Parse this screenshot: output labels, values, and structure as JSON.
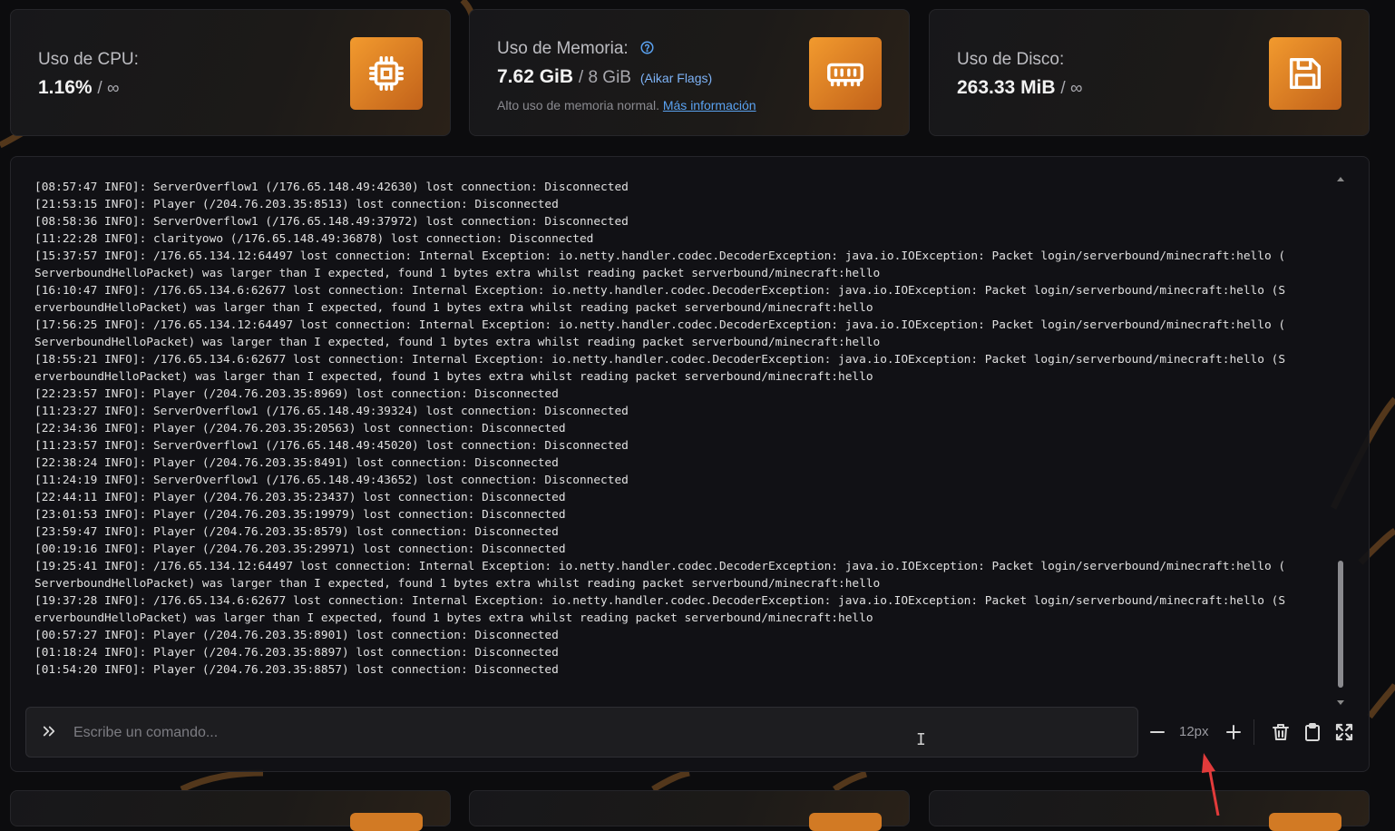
{
  "colors": {
    "accent": "#e8892a",
    "link": "#5aa2f0",
    "background": "#0c0c0e"
  },
  "cpu": {
    "label": "Uso de CPU:",
    "value": "1.16%",
    "sep": "/ ∞",
    "icon": "cpu-icon"
  },
  "memory": {
    "label": "Uso de Memoria:",
    "value": "7.62 GiB",
    "sep": "/ 8 GiB",
    "flags": "(Aikar Flags)",
    "note": "Alto uso de memoria normal.",
    "more_link": "Más información",
    "icon": "memory-icon"
  },
  "disk": {
    "label": "Uso de Disco:",
    "value": "263.33 MiB",
    "sep": "/ ∞",
    "icon": "floppy-disk-icon"
  },
  "console": {
    "lines": [
      "[08:57:47 INFO]: ServerOverflow1 (/176.65.148.49:42630) lost connection: Disconnected",
      "[21:53:15 INFO]: Player (/204.76.203.35:8513) lost connection: Disconnected",
      "[08:58:36 INFO]: ServerOverflow1 (/176.65.148.49:37972) lost connection: Disconnected",
      "[11:22:28 INFO]: clarityowo (/176.65.148.49:36878) lost connection: Disconnected",
      "[15:37:57 INFO]: /176.65.134.12:64497 lost connection: Internal Exception: io.netty.handler.codec.DecoderException: java.io.IOException: Packet login/serverbound/minecraft:hello (",
      "ServerboundHelloPacket) was larger than I expected, found 1 bytes extra whilst reading packet serverbound/minecraft:hello",
      "[16:10:47 INFO]: /176.65.134.6:62677 lost connection: Internal Exception: io.netty.handler.codec.DecoderException: java.io.IOException: Packet login/serverbound/minecraft:hello (S",
      "erverboundHelloPacket) was larger than I expected, found 1 bytes extra whilst reading packet serverbound/minecraft:hello",
      "[17:56:25 INFO]: /176.65.134.12:64497 lost connection: Internal Exception: io.netty.handler.codec.DecoderException: java.io.IOException: Packet login/serverbound/minecraft:hello (",
      "ServerboundHelloPacket) was larger than I expected, found 1 bytes extra whilst reading packet serverbound/minecraft:hello",
      "[18:55:21 INFO]: /176.65.134.6:62677 lost connection: Internal Exception: io.netty.handler.codec.DecoderException: java.io.IOException: Packet login/serverbound/minecraft:hello (S",
      "erverboundHelloPacket) was larger than I expected, found 1 bytes extra whilst reading packet serverbound/minecraft:hello",
      "[22:23:57 INFO]: Player (/204.76.203.35:8969) lost connection: Disconnected",
      "[11:23:27 INFO]: ServerOverflow1 (/176.65.148.49:39324) lost connection: Disconnected",
      "[22:34:36 INFO]: Player (/204.76.203.35:20563) lost connection: Disconnected",
      "[11:23:57 INFO]: ServerOverflow1 (/176.65.148.49:45020) lost connection: Disconnected",
      "[22:38:24 INFO]: Player (/204.76.203.35:8491) lost connection: Disconnected",
      "[11:24:19 INFO]: ServerOverflow1 (/176.65.148.49:43652) lost connection: Disconnected",
      "[22:44:11 INFO]: Player (/204.76.203.35:23437) lost connection: Disconnected",
      "[23:01:53 INFO]: Player (/204.76.203.35:19979) lost connection: Disconnected",
      "[23:59:47 INFO]: Player (/204.76.203.35:8579) lost connection: Disconnected",
      "[00:19:16 INFO]: Player (/204.76.203.35:29971) lost connection: Disconnected",
      "[19:25:41 INFO]: /176.65.134.12:64497 lost connection: Internal Exception: io.netty.handler.codec.DecoderException: java.io.IOException: Packet login/serverbound/minecraft:hello (",
      "ServerboundHelloPacket) was larger than I expected, found 1 bytes extra whilst reading packet serverbound/minecraft:hello",
      "[19:37:28 INFO]: /176.65.134.6:62677 lost connection: Internal Exception: io.netty.handler.codec.DecoderException: java.io.IOException: Packet login/serverbound/minecraft:hello (S",
      "erverboundHelloPacket) was larger than I expected, found 1 bytes extra whilst reading packet serverbound/minecraft:hello",
      "[00:57:27 INFO]: Player (/204.76.203.35:8901) lost connection: Disconnected",
      "[01:18:24 INFO]: Player (/204.76.203.35:8897) lost connection: Disconnected",
      "[01:54:20 INFO]: Player (/204.76.203.35:8857) lost connection: Disconnected"
    ],
    "command_placeholder": "Escribe un comando...",
    "font_size": "12px"
  },
  "toolbar_icons": [
    "minus-icon",
    "plus-icon",
    "trash-icon",
    "clipboard-icon",
    "fullscreen-icon"
  ]
}
